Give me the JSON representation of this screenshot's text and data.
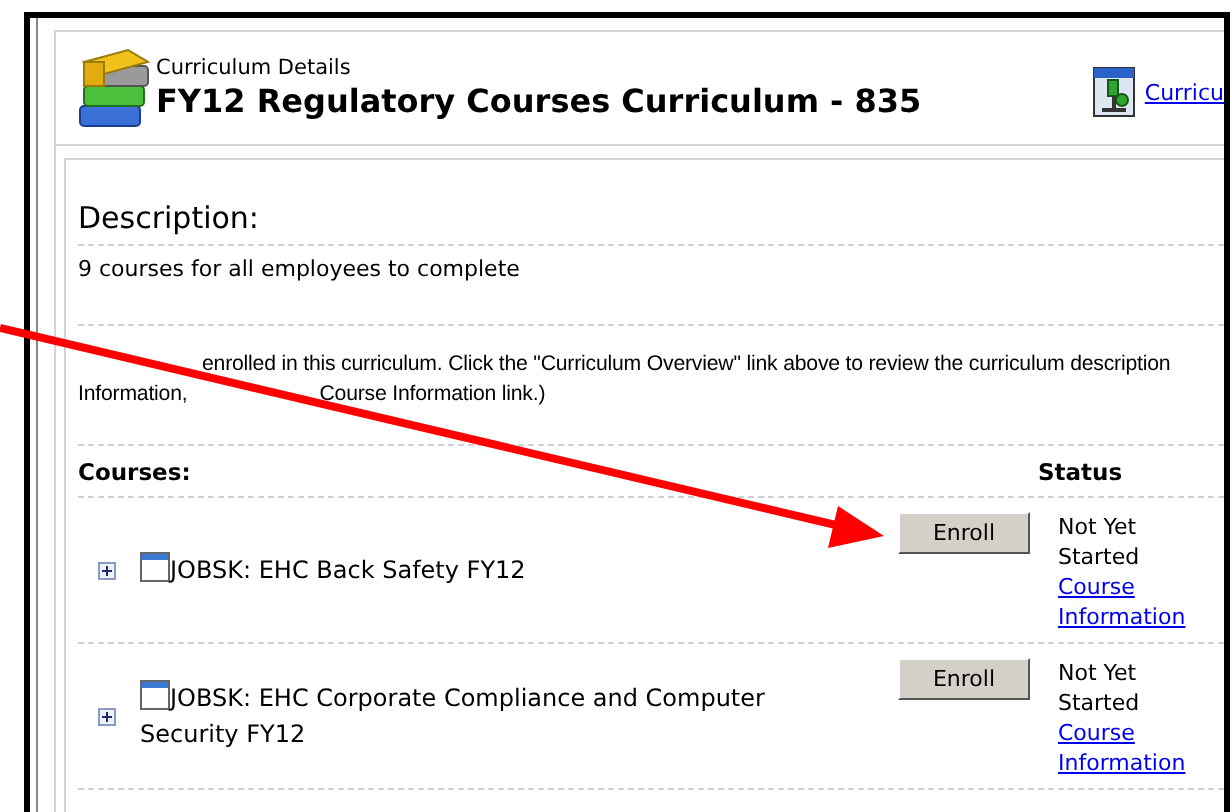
{
  "header": {
    "subtitle": "Curriculum Details",
    "title": "FY12 Regulatory Courses Curriculum - 835",
    "link": "Curricu"
  },
  "description": {
    "heading": "Description:",
    "text": "9 courses for all employees to complete"
  },
  "notice": [
    {
      "after_arrow": "enrolled in this curriculum. Click the \"Curriculum Overview\" link above to review the curriculum description"
    },
    {
      "before_arrow": "Information,",
      "after_arrow": "Course Information link.)"
    }
  ],
  "courses": {
    "heading": "Courses:",
    "status_heading": "Status",
    "rows": [
      {
        "title": "JOBSK: EHC Back Safety FY12",
        "expanded": false,
        "button": "Enroll",
        "status": "Not Yet Started",
        "link": "Course Information"
      },
      {
        "title": "JOBSK: EHC Corporate Compliance and Computer Security FY12",
        "expanded": false,
        "button": "Enroll",
        "status": "Not Yet Started",
        "link": "Course Information"
      }
    ]
  }
}
